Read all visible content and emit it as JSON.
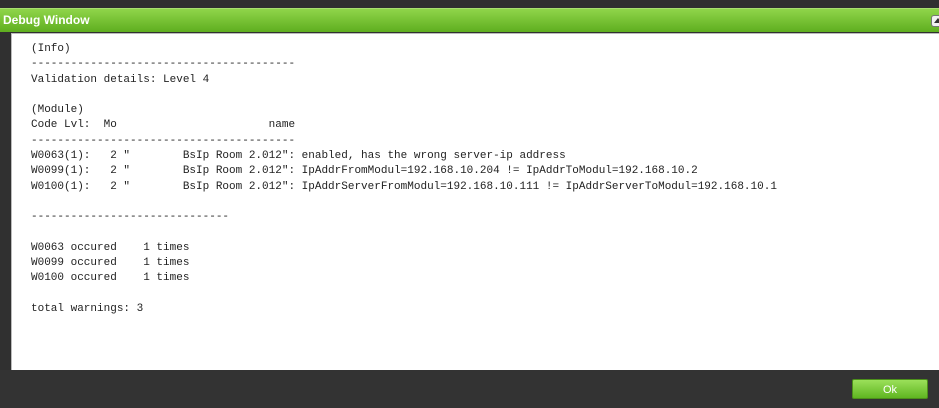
{
  "window": {
    "title": "Debug Window"
  },
  "log": {
    "lines": [
      "(Info)",
      "----------------------------------------",
      "Validation details: Level 4",
      "",
      "(Module)",
      "Code Lvl:  Mo                       name",
      "----------------------------------------",
      "W0063(1):   2 \"        BsIp Room 2.012\": enabled, has the wrong server-ip address",
      "W0099(1):   2 \"        BsIp Room 2.012\": IpAddrFromModul=192.168.10.204 != IpAddrToModul=192.168.10.2",
      "W0100(1):   2 \"        BsIp Room 2.012\": IpAddrServerFromModul=192.168.10.111 != IpAddrServerToModul=192.168.10.1",
      "",
      "------------------------------",
      "",
      "W0063 occured    1 times",
      "W0099 occured    1 times",
      "W0100 occured    1 times",
      "",
      "total warnings: 3"
    ]
  },
  "footer": {
    "ok_label": "Ok"
  },
  "colors": {
    "titlebar": "#6fc02f",
    "ok_button": "#7cc93e",
    "background": "#303030"
  },
  "icons": {
    "collapse": "chevron-up-icon"
  }
}
